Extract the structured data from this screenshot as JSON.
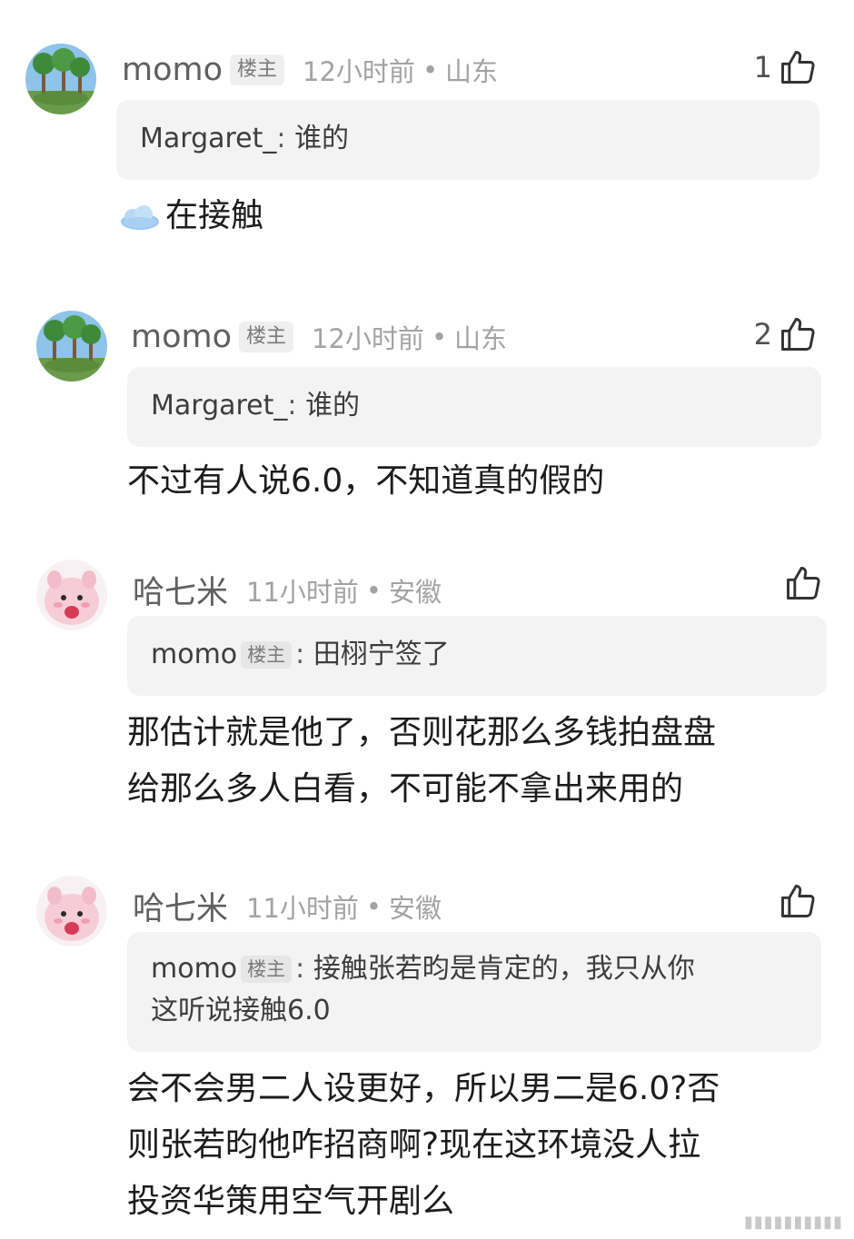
{
  "comments": [
    {
      "name": "momo",
      "badge": "楼主",
      "time": "12小时前",
      "sep": "•",
      "location": "山东",
      "likes": "1",
      "avatar": "palm-trees-avatar",
      "quote": {
        "author": "Margaret_",
        "sep": ":",
        "text": "谁的"
      },
      "emoji": "cloud-emoji",
      "body": "在接触"
    },
    {
      "name": "momo",
      "badge": "楼主",
      "time": "12小时前",
      "sep": "•",
      "location": "山东",
      "likes": "2",
      "avatar": "palm-trees-avatar",
      "quote": {
        "author": "Margaret_",
        "sep": ":",
        "text": "谁的"
      },
      "body": "不过有人说6.0，不知道真的假的"
    },
    {
      "name": "哈七米",
      "time": "11小时前",
      "sep": "•",
      "location": "安徽",
      "likes": "",
      "avatar": "pink-plush-avatar",
      "quote": {
        "author": "momo",
        "badge": "楼主",
        "sep": ":",
        "text": "田栩宁签了"
      },
      "body_lines": [
        "那估计就是他了，否则花那么多钱拍盘盘",
        "给那么多人白看，不可能不拿出来用的"
      ]
    },
    {
      "name": "哈七米",
      "time": "11小时前",
      "sep": "•",
      "location": "安徽",
      "likes": "",
      "avatar": "pink-plush-avatar",
      "quote": {
        "author": "momo",
        "badge": "楼主",
        "sep": ":",
        "text_lines": [
          "接触张若昀是肯定的，我只从你",
          "这听说接触6.0"
        ]
      },
      "body_lines": [
        "会不会男二人设更好，所以男二是6.0?否",
        "则张若昀他咋招商啊?现在这环境没人拉",
        "投资华策用空气开剧么"
      ]
    }
  ],
  "colors": {
    "quote_bg": "#f3f3f3",
    "meta_gray": "#a3a3a3",
    "name_gray": "#5f5f5f"
  }
}
